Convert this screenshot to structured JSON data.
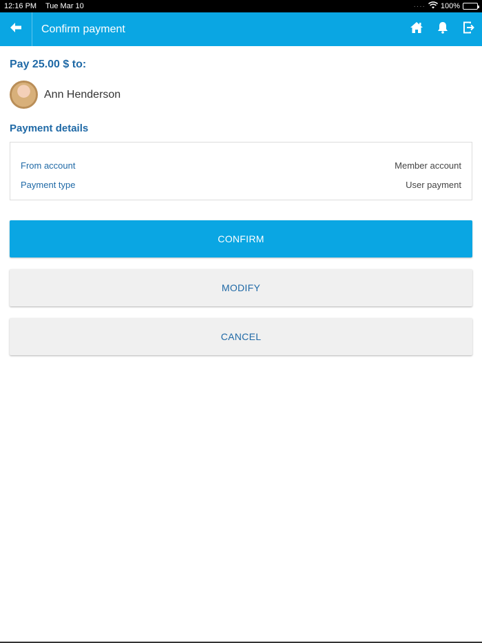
{
  "status_bar": {
    "time": "12:16 PM",
    "date": "Tue Mar 10",
    "battery": "100%"
  },
  "app_bar": {
    "title": "Confirm payment",
    "back_icon": "arrow-left-icon",
    "actions": [
      "home-icon",
      "bell-icon",
      "logout-icon"
    ]
  },
  "payment": {
    "heading": "Pay 25.00 $ to:",
    "recipient_name": "Ann Henderson"
  },
  "details": {
    "title": "Payment details",
    "rows": [
      {
        "label": "From account",
        "value": "Member account"
      },
      {
        "label": "Payment type",
        "value": "User payment"
      }
    ]
  },
  "buttons": {
    "confirm": "CONFIRM",
    "modify": "MODIFY",
    "cancel": "CANCEL"
  },
  "colors": {
    "primary": "#0aa6e3",
    "text_accent": "#1f69a6",
    "button_secondary_bg": "#f0f0f0"
  }
}
